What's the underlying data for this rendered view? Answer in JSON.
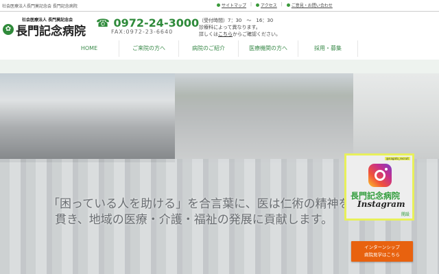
{
  "topbar": {
    "corporation": "社会医療法人長門莫記念会 長門記念病院",
    "links": [
      "サイトマップ",
      "アクセス",
      "ご意見・お問い合わせ"
    ]
  },
  "logo": {
    "sub": "社会医療法人 長門莫記念会",
    "name": "長門記念病院"
  },
  "contact": {
    "phone": "☎ 0972-24-3000",
    "fax": "FAX:0972-23-6640"
  },
  "hours": {
    "line1": "（受付時間）7：30　～　16：30",
    "line2": "診療科によって異なります。",
    "line3_pre": "詳しくは",
    "line3_link": "こちら",
    "line3_post": "からご確認ください。"
  },
  "nav": [
    "HOME",
    "ご来院の方へ",
    "病院のご紹介",
    "医療機関の方へ",
    "採用・募集"
  ],
  "hero": {
    "slogan_line1": "「困っている人を助ける」を合言葉に、医は仁術の精神を",
    "slogan_line2": "貫き、地域の医療・介護・福祉の発展に貢献します。"
  },
  "instagram": {
    "account": "@nagato_recruit",
    "hospital": "長門記念病院",
    "label": "Instagram",
    "open": "開設"
  },
  "cta": {
    "line1": "インターンシップ",
    "line2": "病院見学はこちら"
  },
  "colors": {
    "brand": "#2e8a3a",
    "cta": "#e8620f"
  }
}
